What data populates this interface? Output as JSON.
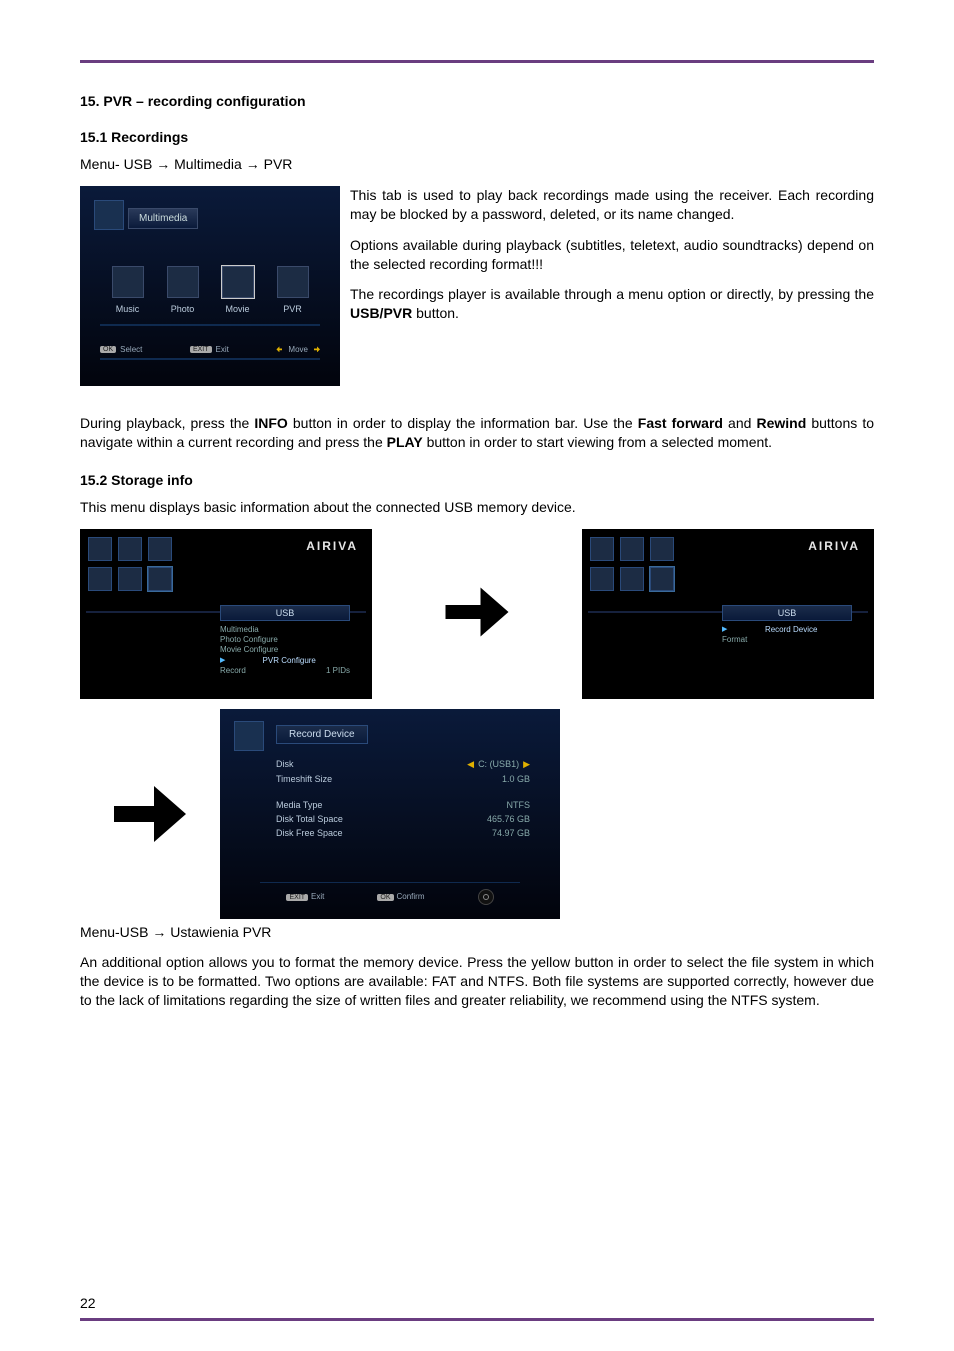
{
  "section": {
    "heading": "15. PVR – recording configuration",
    "s151_heading": "15.1 Recordings",
    "menu_path": "Menu- USB → Multimedia → PVR",
    "p1": "This tab is used to play back recordings made using the receiver. Each recording may be blocked by a password, deleted, or its name changed.",
    "p2": "Options available during playback (subtitles, teletext, audio soundtracks) depend on the selected recording format!!!",
    "p3_a": "The recordings player is available through a menu option or directly, by pressing the ",
    "p3_b_bold": "USB/PVR",
    "p3_c": " button.",
    "p4_a": "During playback, press the ",
    "p4_b": "INFO",
    "p4_c": " button in order to display the information bar. Use the ",
    "p4_d": "Fast forward",
    "p4_e": " and ",
    "p4_f": "Rewind",
    "p4_g": " buttons to navigate within a current recording and press the ",
    "p4_h": "PLAY",
    "p4_i": " button in order to start viewing from a selected moment.",
    "s152_heading": "15.2 Storage info",
    "p5": "This menu displays basic information about the connected USB memory device.",
    "menu_path2": "Menu-USB → Ustawienia PVR",
    "p6": "An additional option allows you to format the memory device. Press the yellow button in order to select the file system in which the device is to be formatted. Two options are available: FAT and NTFS. Both file systems are supported correctly, however due to the lack of limitations regarding the size of written files and greater reliability, we recommend using the NTFS system."
  },
  "multimedia_screen": {
    "title": "Multimedia",
    "items": [
      "Music",
      "Photo",
      "Movie",
      "PVR"
    ],
    "footer_select": "Select",
    "footer_exit": "Exit",
    "footer_move": "Move"
  },
  "ariva_logo": "AIRIVA",
  "usb_panel_a": {
    "title": "USB",
    "items": [
      {
        "label": "Multimedia",
        "value": ""
      },
      {
        "label": "Photo Configure",
        "value": ""
      },
      {
        "label": "Movie Configure",
        "value": ""
      },
      {
        "label": "PVR Configure",
        "value": "",
        "sel": true
      },
      {
        "label": "Record",
        "value": "1 PIDs"
      }
    ]
  },
  "usb_panel_b": {
    "title": "USB",
    "items": [
      {
        "label": "Record Device",
        "value": "",
        "sel": true
      },
      {
        "label": "Format",
        "value": ""
      }
    ]
  },
  "record_device": {
    "title": "Record Device",
    "rows": [
      {
        "label": "Disk",
        "value": "C: (USB1)",
        "select": true
      },
      {
        "label": "Timeshift Size",
        "value": "1.0 GB"
      },
      {
        "label": "",
        "value": ""
      },
      {
        "label": "Media Type",
        "value": "NTFS"
      },
      {
        "label": "Disk Total Space",
        "value": "465.76 GB"
      },
      {
        "label": "Disk Free Space",
        "value": "74.97 GB"
      }
    ],
    "footer_exit": "Exit",
    "footer_confirm": "Confirm"
  },
  "page_number": "22"
}
